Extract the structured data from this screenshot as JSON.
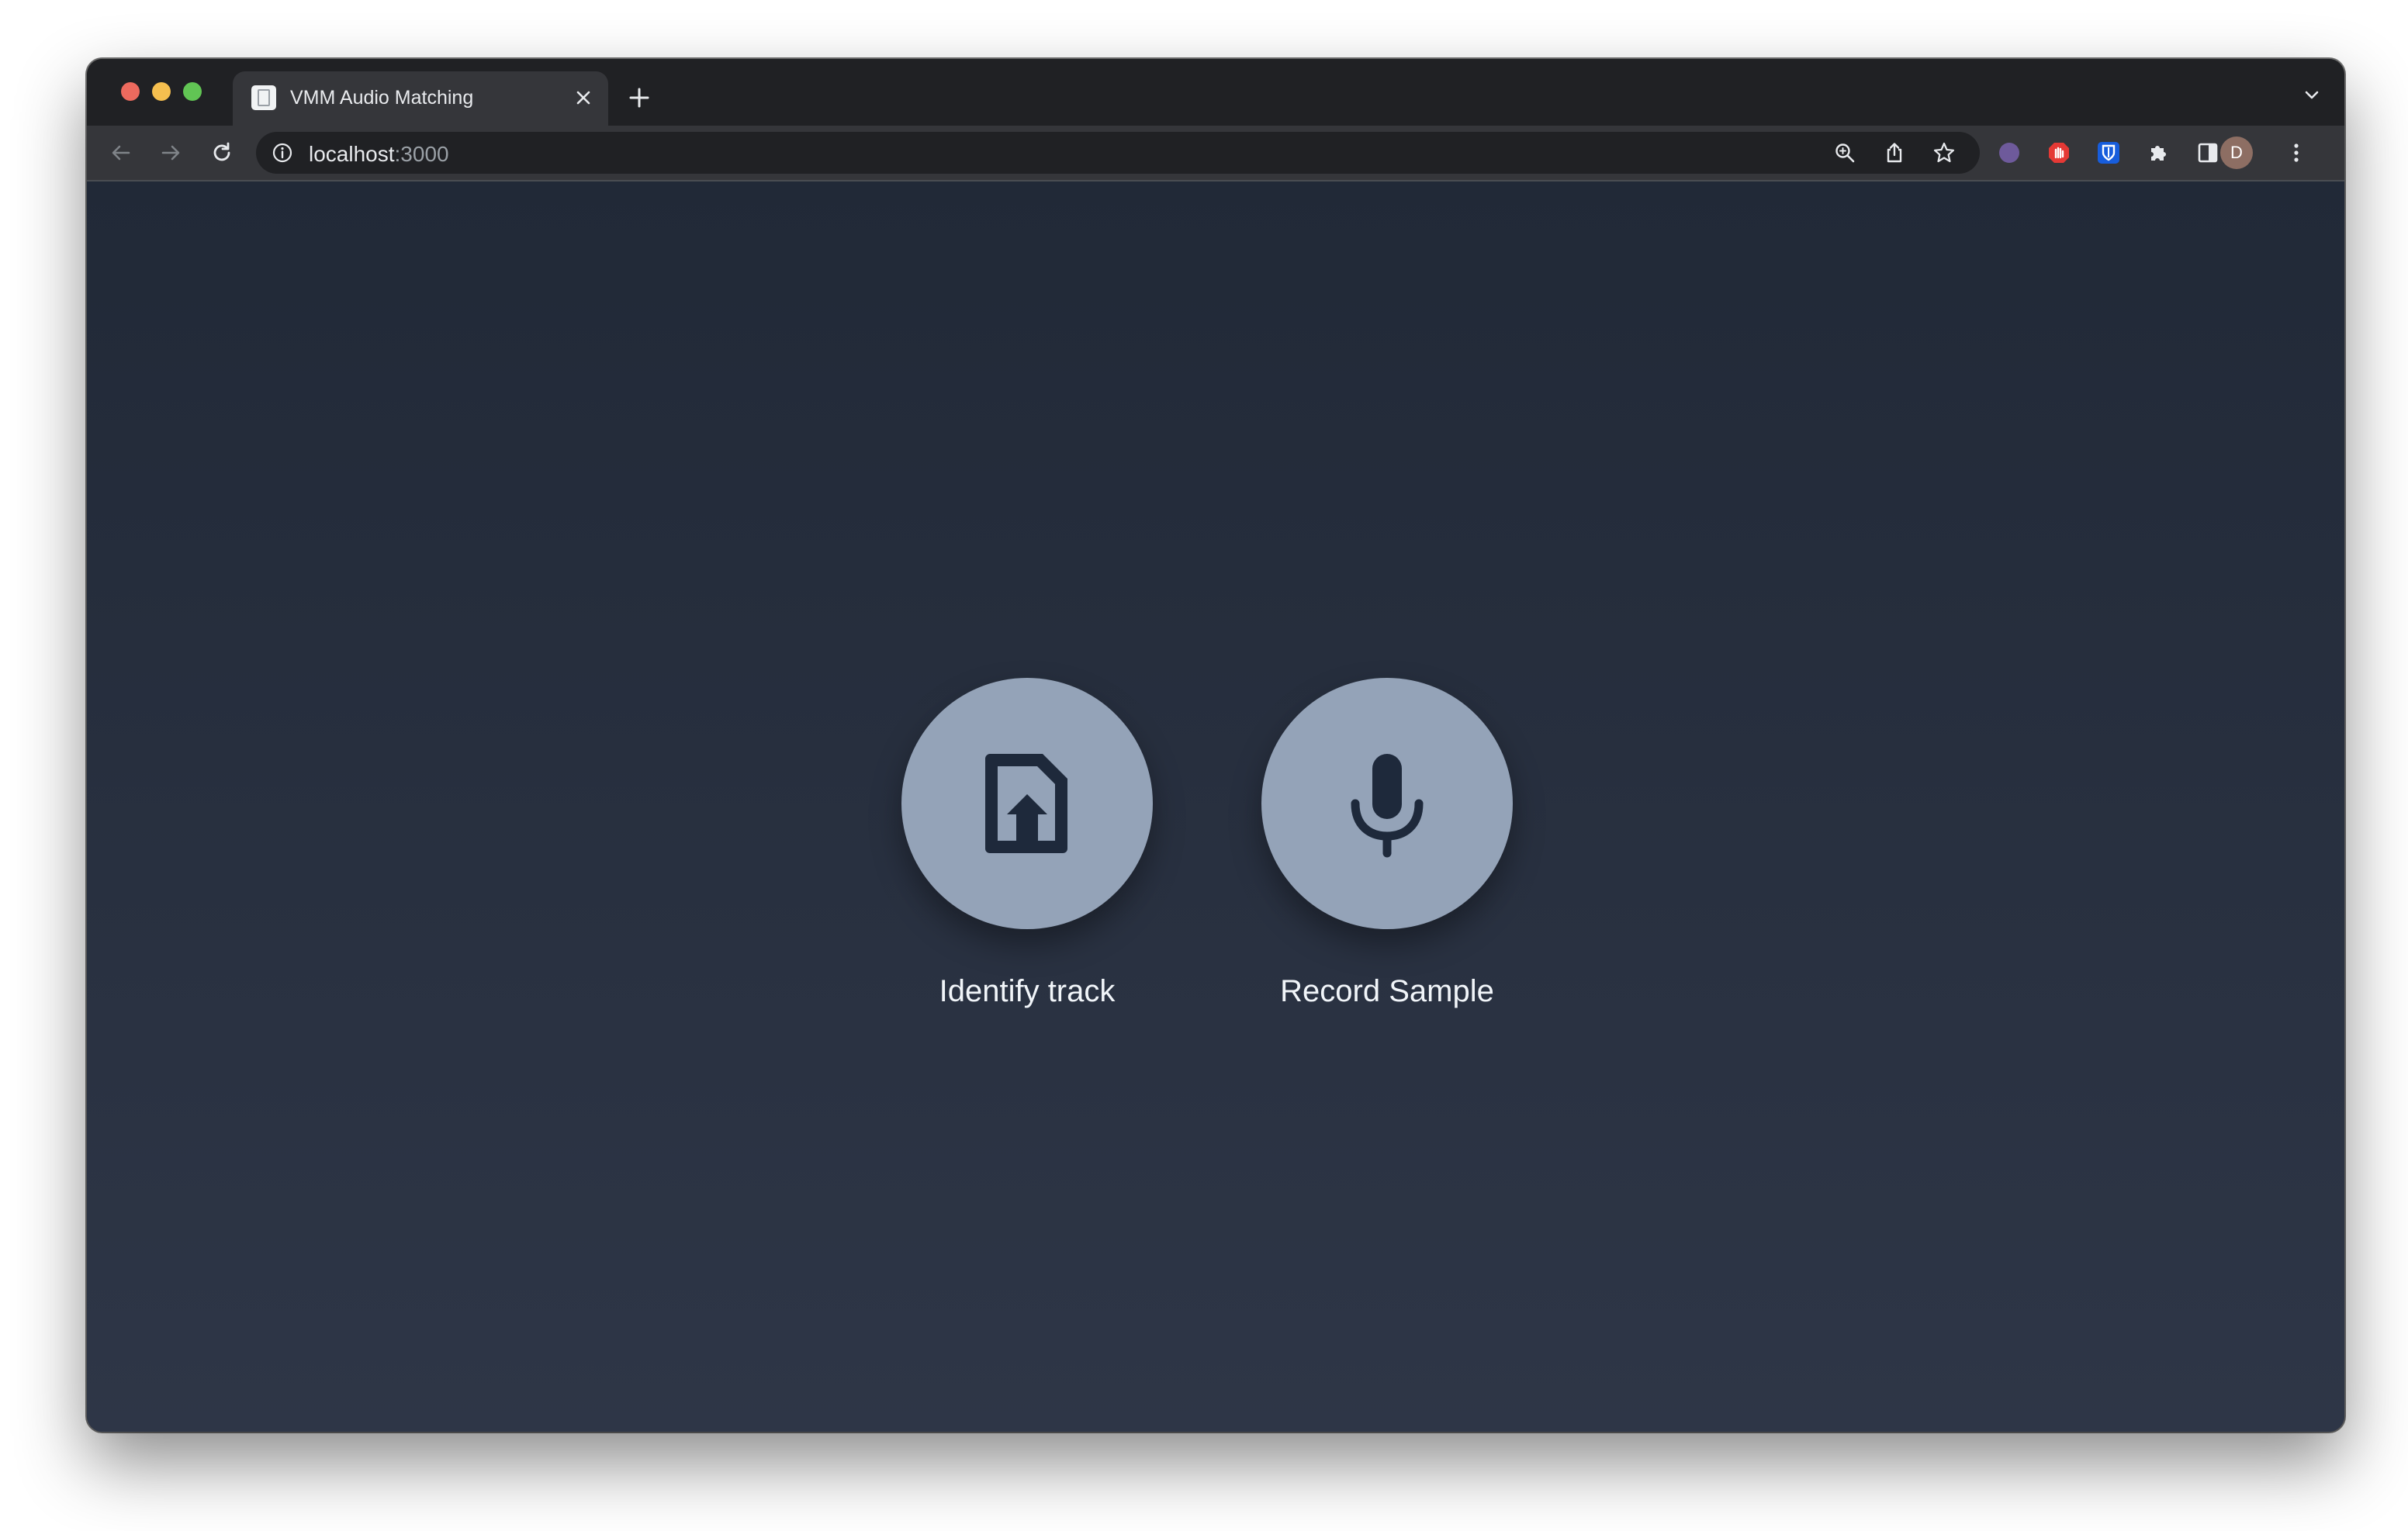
{
  "browser": {
    "tab": {
      "title": "VMM Audio Matching",
      "favicon": "document-favicon-icon"
    },
    "address": {
      "host": "localhost",
      "port": ":3000"
    },
    "profile_initial": "D",
    "extensions": [
      "eclipse-extension-icon",
      "ad-blocker-extension-icon",
      "bitwarden-extension-icon",
      "puzzle-extensions-icon",
      "sidebar-icon"
    ]
  },
  "actions": [
    {
      "label": "Identify track",
      "icon": "file-upload-icon"
    },
    {
      "label": "Record Sample",
      "icon": "microphone-icon"
    }
  ],
  "colors": {
    "page_bg_top": "#212937",
    "page_bg_bottom": "#2e3647",
    "button": "#94a3b8",
    "icon": "#1e293b",
    "label": "#f1f5f9"
  }
}
